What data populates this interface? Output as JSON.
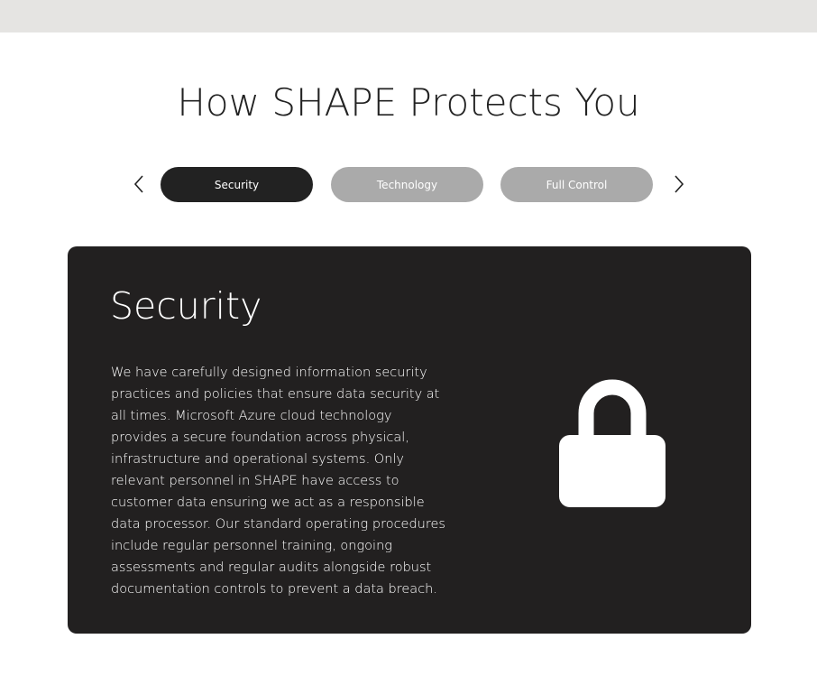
{
  "header": {
    "title": "How SHAPE Protects You"
  },
  "tabs": [
    {
      "label": "Security",
      "active": true
    },
    {
      "label": "Technology",
      "active": false
    },
    {
      "label": "Full Control",
      "active": false
    }
  ],
  "carousel": {
    "prev_icon": "chevron-left-icon",
    "next_icon": "chevron-right-icon"
  },
  "panel": {
    "title": "Security",
    "body": "We have carefully designed information security practices and policies that ensure data security at all times. Microsoft Azure cloud technology provides a secure foundation across physical, infrastructure and operational systems. Only relevant personnel in SHAPE have access to customer data ensuring we act as a responsible data processor. Our standard operating procedures include regular personnel training, ongoing assessments and regular audits alongside robust documentation controls to prevent a data breach.",
    "icon": "lock-icon"
  },
  "colors": {
    "top_bar": "#e5e4e2",
    "active_tab": "#222222",
    "inactive_tab": "#aaaaaa",
    "panel_bg": "#222020"
  }
}
